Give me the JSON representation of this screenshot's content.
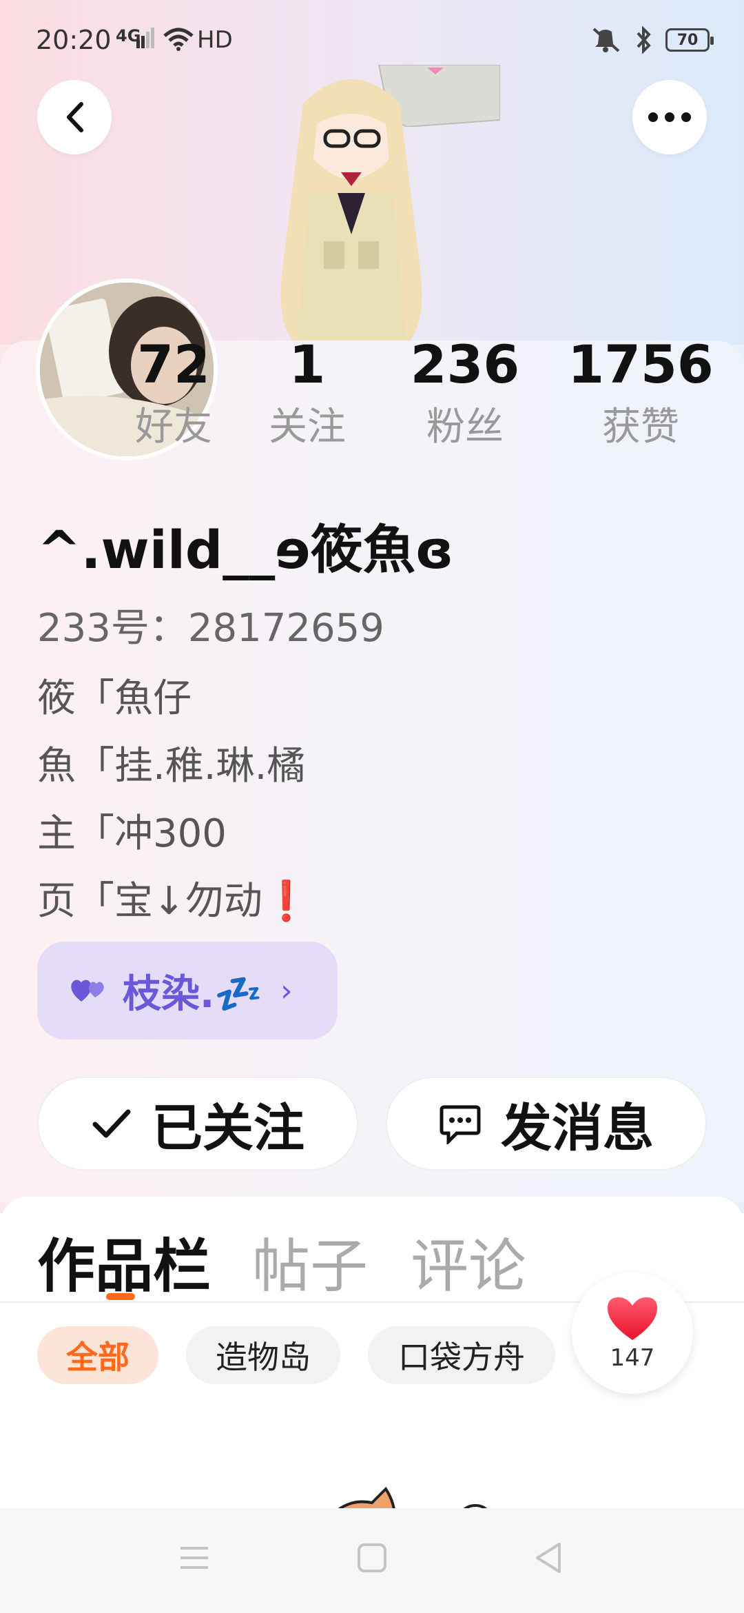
{
  "status_bar": {
    "time": "20:20",
    "network": "4G",
    "hd": "HD",
    "battery": "70"
  },
  "profile": {
    "stats": [
      {
        "value": "72",
        "label": "好友"
      },
      {
        "value": "1",
        "label": "关注"
      },
      {
        "value": "236",
        "label": "粉丝"
      },
      {
        "value": "1756",
        "label": "获赞"
      }
    ],
    "username": "^.wild__ɘ筱魚ɞ",
    "uid": "233号：28172659",
    "bio_lines": [
      "筱「魚仔",
      "魚「挂.稚.琳.橘",
      "主「冲300",
      "页「宝↓勿动"
    ],
    "bio_exclaim": "❗",
    "fan_tag": {
      "label": "枝染.💤"
    }
  },
  "actions": {
    "followed_label": "已关注",
    "message_label": "发消息"
  },
  "tabs": [
    {
      "label": "作品栏",
      "active": true
    },
    {
      "label": "帖子",
      "active": false
    },
    {
      "label": "评论",
      "active": false
    }
  ],
  "chips": [
    {
      "label": "全部",
      "active": true
    },
    {
      "label": "造物岛",
      "active": false
    },
    {
      "label": "口袋方舟",
      "active": false
    }
  ],
  "like_fab": {
    "count": "147",
    "icon": "heart-icon"
  },
  "colors": {
    "accent": "#ff6a1a",
    "fan_tag_text": "#6a58d8",
    "fan_tag_bg": "#e5dcf7",
    "like_heart": "#f0263c"
  }
}
